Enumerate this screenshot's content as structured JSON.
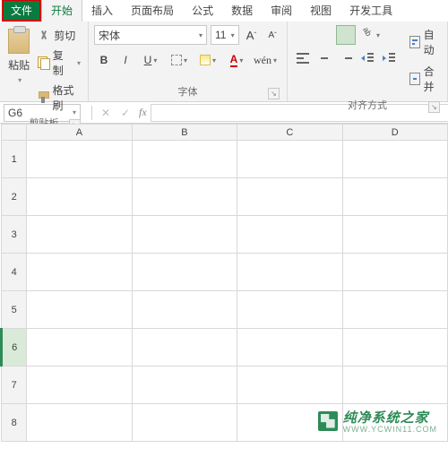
{
  "tabs": {
    "file": "文件",
    "home": "开始",
    "insert": "插入",
    "layout": "页面布局",
    "formulas": "公式",
    "data": "数据",
    "review": "审阅",
    "view": "视图",
    "dev": "开发工具"
  },
  "clipboard": {
    "paste": "粘贴",
    "cut": "剪切",
    "copy": "复制",
    "format_painter": "格式刷",
    "group_label": "剪贴板"
  },
  "font": {
    "name": "宋体",
    "size": "11",
    "bold": "B",
    "italic": "I",
    "underline": "U",
    "fontcolor_glyph": "A",
    "phonetic": "wén",
    "grow": "A",
    "shrink": "A",
    "group_label": "字体"
  },
  "align": {
    "wrap": "自动",
    "merge": "合并",
    "group_label": "对齐方式"
  },
  "namebox": {
    "value": "G6"
  },
  "fx": {
    "label": "fx",
    "cancel": "✕",
    "confirm": "✓"
  },
  "grid": {
    "cols": [
      "A",
      "B",
      "C",
      "D"
    ],
    "rows": [
      "1",
      "2",
      "3",
      "4",
      "5",
      "6",
      "7",
      "8"
    ],
    "selected_row": "6"
  },
  "watermark": {
    "text": "纯净系统之家",
    "sub": "WWW.YCWIN11.COM"
  }
}
